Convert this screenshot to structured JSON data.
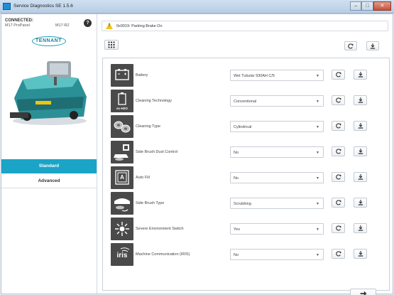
{
  "window": {
    "title": "Service Diagnostics SE 1.5.6",
    "controls": [
      "–",
      "□",
      "✕"
    ]
  },
  "sidebar": {
    "connection_label": "CONNECTED:",
    "connection_device": "M17 ProPanel",
    "device_id": "M17-R2",
    "help_icon_text": "?",
    "brand_text": "TENNANT",
    "nav": [
      {
        "label": "Standard",
        "active": true
      },
      {
        "label": "Advanced",
        "active": false
      }
    ]
  },
  "alert": {
    "icon": "warning-icon",
    "icon_text": "!",
    "text": "0x0019: Parking Brake On"
  },
  "settings": [
    {
      "label": "Battery",
      "value": "Wet Tubular 930AH C/5",
      "icon": "battery-icon"
    },
    {
      "label": "Cleaning Technology",
      "value": "Conventional",
      "icon": "cleaning-technology-icon",
      "icon_caption": "ec-H2O"
    },
    {
      "label": "Cleaning Type",
      "value": "Cylindrical",
      "icon": "brush-type-icon"
    },
    {
      "label": "Side Brush Dust Control",
      "value": "No",
      "icon": "dust-control-icon"
    },
    {
      "label": "Auto Fill",
      "value": "No",
      "icon": "auto-fill-icon",
      "icon_text": "A"
    },
    {
      "label": "Side Brush Type",
      "value": "Scrubbing",
      "icon": "side-brush-icon"
    },
    {
      "label": "Severe Environment Switch",
      "value": "Yes",
      "icon": "severe-environment-icon"
    },
    {
      "label": "Machine Communication (IRIS)",
      "value": "No",
      "icon": "iris-icon",
      "icon_text": "iris"
    }
  ],
  "colors": {
    "accent": "#1aa4c8",
    "icon_bg": "#4a4a4a",
    "warning": "#f0c419"
  }
}
